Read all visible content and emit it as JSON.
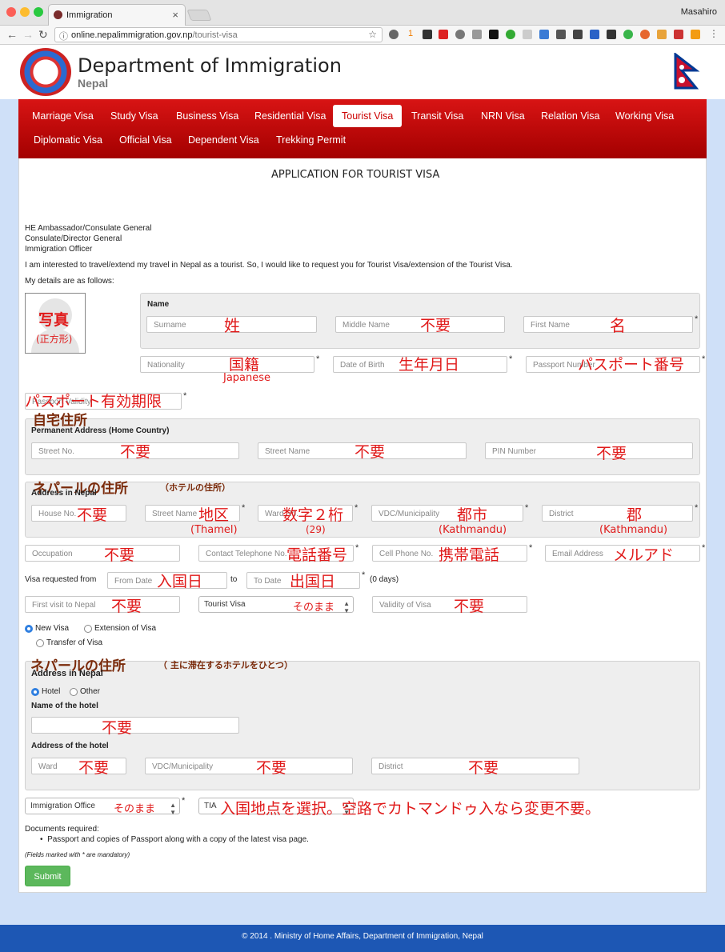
{
  "browser": {
    "tab_title": "Immigration",
    "tab_close": "×",
    "user": "Masahiro",
    "url_host": "online.nepalimmigration.gov.np",
    "url_path": "/tourist-visa",
    "ext_badge": "1"
  },
  "header": {
    "title": "Department of Immigration",
    "subtitle": "Nepal"
  },
  "nav": {
    "items": [
      "Marriage Visa",
      "Study Visa",
      "Business Visa",
      "Residential Visa",
      "Tourist Visa",
      "Transit Visa",
      "NRN Visa",
      "Relation Visa",
      "Working Visa",
      "Diplomatic Visa",
      "Official Visa",
      "Dependent Visa",
      "Trekking Permit"
    ],
    "active": "Tourist Visa"
  },
  "form": {
    "heading": "APPLICATION FOR TOURIST VISA",
    "addressee": [
      "HE Ambassador/Consulate General",
      "Consulate/Director General",
      "Immigration Officer"
    ],
    "intro": "I am interested to travel/extend my travel in Nepal as a tourist. So, I would like to request you for Tourist Visa/extension of the Tourist Visa.",
    "details_label": "My details are as follows:",
    "name_label": "Name",
    "surname_ph": "Surname",
    "middle_ph": "Middle Name",
    "first_ph": "First Name",
    "nationality_ph": "Nationality",
    "dob_ph": "Date of Birth",
    "passport_ph": "Passport Number",
    "passport_validity_ph": "Passport Validity",
    "perm_addr_label": "Permanent Address (Home Country)",
    "street_no_ph": "Street No.",
    "street_name_ph": "Street Name",
    "pin_ph": "PIN Number",
    "nepal_addr_label": "Address in Nepal",
    "house_no_ph": "House No.",
    "street_name2_ph": "Street Name",
    "ward_ph": "Ward No.",
    "vdc_ph": "VDC/Municipality",
    "district_ph": "District",
    "occupation_ph": "Occupation",
    "contact_tel_ph": "Contact Telephone No.",
    "cell_ph": "Cell Phone No.",
    "email_ph": "Email Address",
    "visa_requested_label": "Visa requested from",
    "from_date_ph": "From Date",
    "to_label": "to",
    "to_date_ph": "To Date",
    "days_text": "(0 days)",
    "first_visit_ph": "First visit to Nepal",
    "visa_type_value": "Tourist Visa",
    "validity_ph": "Validity of Visa",
    "radio_new": "New Visa",
    "radio_extension": "Extension of Visa",
    "radio_transfer": "Transfer of Visa",
    "address2_label": "Address in Nepal",
    "radio_hotel": "Hotel",
    "radio_other": "Other",
    "hotel_name_label": "Name of the hotel",
    "hotel_addr_label": "Address of the hotel",
    "ward2_ph": "Ward",
    "vdc2_ph": "VDC/Municipality",
    "district2_ph": "District",
    "office_value": "Immigration Office",
    "office_code_value": "TIA",
    "documents_label": "Documents required:",
    "documents_item": "Passport and copies of Passport along with a copy of the latest visa page.",
    "mandatory_note": "(Fields marked with * are mandatory)",
    "submit_label": "Submit",
    "asterisk": "*"
  },
  "annotations": {
    "photo": "写真",
    "photo_sub": "(正方形)",
    "surname": "姓",
    "middle": "不要",
    "first": "名",
    "nationality": "国籍",
    "nationality_sub": "Japanese",
    "dob": "生年月日",
    "passport": "パスポート番号",
    "passport_validity": "パスポート有効期限",
    "home_heading": "自宅住所",
    "street_no": "不要",
    "street_name": "不要",
    "pin": "不要",
    "nepal_heading": "ネパールの住所",
    "nepal_heading_sub": "（ホテルの住所）",
    "house_no": "不要",
    "street_name2": "地区",
    "street_name2_sub": "(Thamel)",
    "ward": "数字２桁",
    "ward_sub": "(29)",
    "vdc": "都市",
    "vdc_sub": "(Kathmandu)",
    "district": "郡",
    "district_sub": "(Kathmandu)",
    "occupation": "不要",
    "contact_tel": "電話番号",
    "cell": "携帯電話",
    "email": "メルアド",
    "from_date": "入国日",
    "to_date": "出国日",
    "first_visit": "不要",
    "visa_type": "そのまま",
    "validity": "不要",
    "nepal2_heading": "ネパールの住所",
    "nepal2_heading_sub": "（ 主に滞在するホテルをひとつ）",
    "hotel_name": "不要",
    "ward2": "不要",
    "vdc2": "不要",
    "district2": "不要",
    "office": "そのまま",
    "office_code": "入国地点を選択。空路でカトマンドゥ入なら変更不要。"
  },
  "footer": {
    "text": "© 2014 . Ministry of Home Affairs, Department of Immigration, Nepal"
  },
  "colors": {
    "nav_red": "#c80a0a",
    "annotation_red": "#e01a1a",
    "footer_blue": "#1d57b4",
    "submit_green": "#5cb85c"
  }
}
